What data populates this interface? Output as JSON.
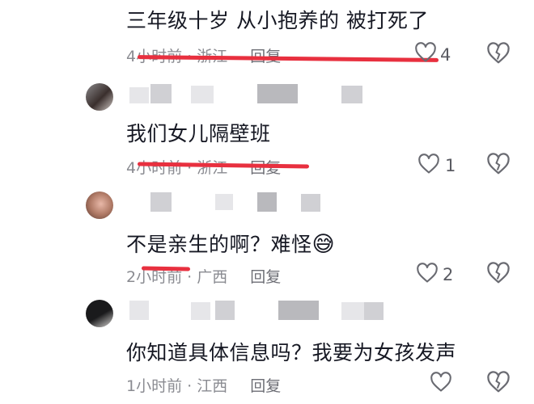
{
  "comments": [
    {
      "text": "三年级十岁 从小抱养的 被打死了",
      "time": "4小时前",
      "location": "浙江",
      "reply": "回复",
      "likes": "4"
    },
    {
      "text": "我们女儿隔壁班",
      "time": "4小时前",
      "location": "浙江",
      "reply": "回复",
      "likes": "1"
    },
    {
      "text": "不是亲生的啊？难怪",
      "emoji": "😅",
      "time": "2小时前",
      "location": "广西",
      "reply": "回复",
      "likes": "2"
    },
    {
      "text": "你知道具体信息吗？我要为女孩发声",
      "time": "1小时前",
      "location": "江西",
      "reply": "回复",
      "likes": ""
    }
  ],
  "colors": {
    "annotation": "#e8303f",
    "text": "#161823",
    "meta": "#8a8b91"
  },
  "icons": [
    "heart-outline-icon",
    "broken-heart-icon"
  ]
}
